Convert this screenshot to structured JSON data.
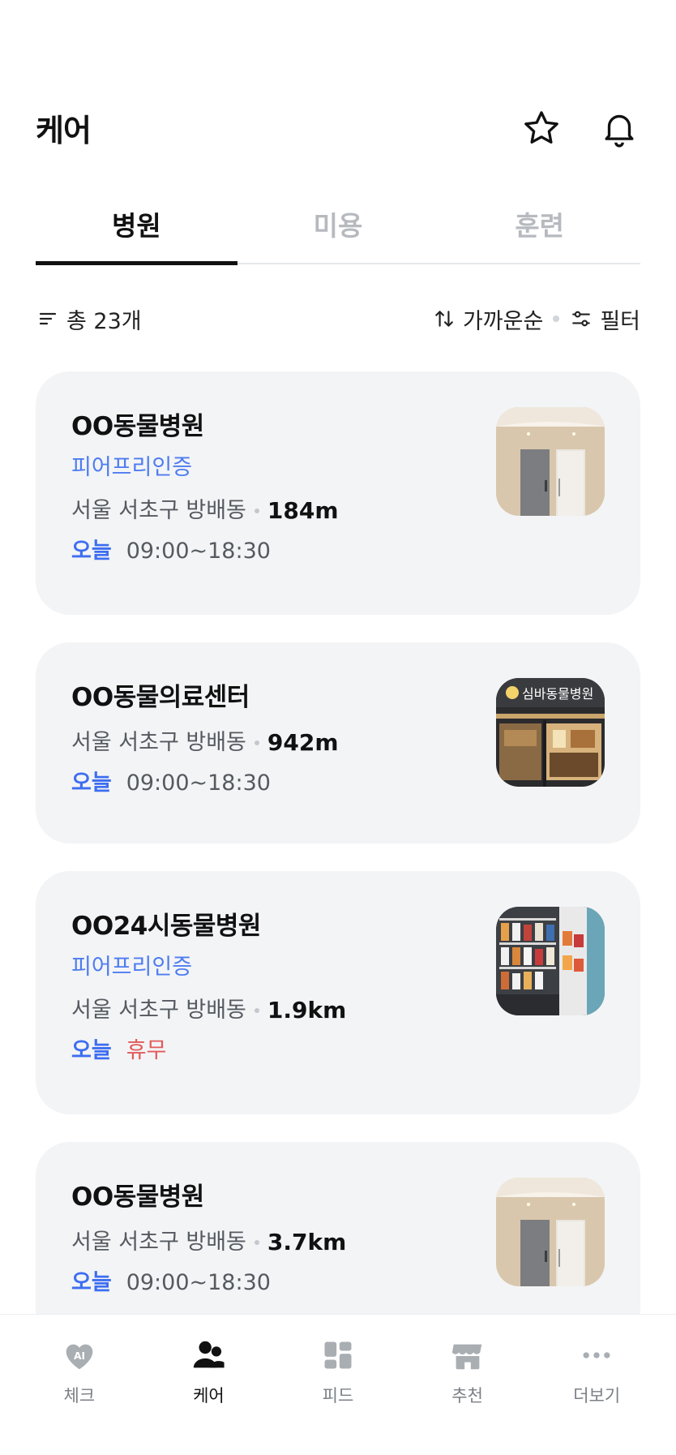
{
  "header": {
    "title": "케어",
    "icons": [
      "star-icon",
      "bell-icon"
    ]
  },
  "tabs": [
    {
      "label": "병원",
      "active": true
    },
    {
      "label": "미용",
      "active": false
    },
    {
      "label": "훈련",
      "active": false
    }
  ],
  "toolbar": {
    "total": "총 23개",
    "sort_label": "가까운순",
    "filter_label": "필터"
  },
  "clinics": [
    {
      "name": "OO동물병원",
      "cert": "피어프리인증",
      "address": "서울 서초구 방배동",
      "distance": "184m",
      "today_label": "오늘",
      "hours": "09:00~18:30"
    },
    {
      "name": "OO동물의료센터",
      "cert": "",
      "address": "서울 서초구 방배동",
      "distance": "942m",
      "today_label": "오늘",
      "hours": "09:00~18:30"
    },
    {
      "name": "OO24시동물병원",
      "cert": "피어프리인증",
      "address": "서울 서초구 방배동",
      "distance": "1.9km",
      "today_label": "오늘",
      "hours": "휴무"
    },
    {
      "name": "OO동물병원",
      "cert": "",
      "address": "서울 서초구 방배동",
      "distance": "3.7km",
      "today_label": "오늘",
      "hours": "09:00~18:30"
    }
  ],
  "thumb_sign_text": "심바동물병원",
  "bottom_nav": [
    {
      "label": "체크",
      "icon": "ai-heart-icon",
      "active": false
    },
    {
      "label": "케어",
      "icon": "people-icon",
      "active": true
    },
    {
      "label": "피드",
      "icon": "grid-icon",
      "active": false
    },
    {
      "label": "추천",
      "icon": "store-icon",
      "active": false
    },
    {
      "label": "더보기",
      "icon": "more-dots-icon",
      "active": false
    }
  ],
  "colors": {
    "accent_blue": "#3d6ef0",
    "cert_blue": "#4e7cf0",
    "closed_red": "#e25a5a",
    "card_bg": "#f3f4f6"
  }
}
